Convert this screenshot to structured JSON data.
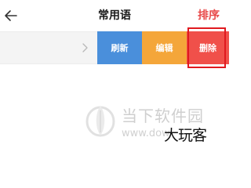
{
  "header": {
    "title": "常用语",
    "sort_label": "排序",
    "back_icon": "back-arrow-icon"
  },
  "row": {
    "chevron_icon": "chevron-right-icon",
    "actions": {
      "refresh_label": "刷新",
      "edit_label": "编辑",
      "delete_label": "删除"
    }
  },
  "watermark": {
    "brand_cn": "当下软件园",
    "url_text": "www.dow",
    "overlay_text": "大玩客",
    "logo_icon": "downxia-logo-icon"
  },
  "colors": {
    "accent_red": "#e84a4a",
    "refresh_blue": "#4a8fdb",
    "edit_orange": "#f4a63a",
    "delete_red": "#f0504a",
    "highlight_red": "#e0191f"
  }
}
